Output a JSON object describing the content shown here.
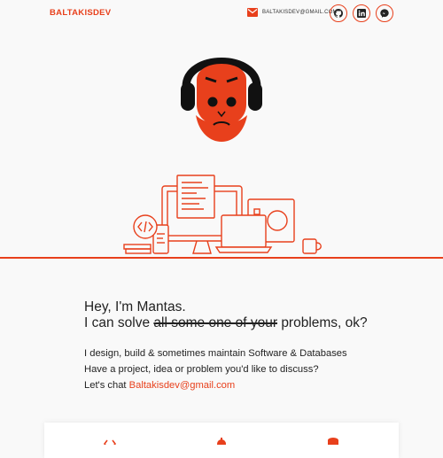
{
  "header": {
    "logo": "BALTAKISDEV",
    "email": "BALTAKISDEV@GMAIL.COM",
    "social_icons": [
      "github-icon",
      "linkedin-icon",
      "messenger-icon"
    ]
  },
  "colors": {
    "accent": "#e8401c",
    "background": "#f9f9f9",
    "text": "#222222"
  },
  "intro": {
    "greeting": "Hey, I'm Mantas.",
    "solve_prefix": "I can solve",
    "struck_text": "all some one of your",
    "solve_suffix": "problems, ok?",
    "line1": "I design, build & sometimes maintain Software & Databases",
    "line2": "Have a project, idea or problem you'd like to discuss?",
    "chat_prefix": "Let's chat",
    "chat_link": "Baltakisdev@gmail.com"
  },
  "services": {
    "icons": [
      "code-icon",
      "gear-icon",
      "database-icon"
    ]
  }
}
